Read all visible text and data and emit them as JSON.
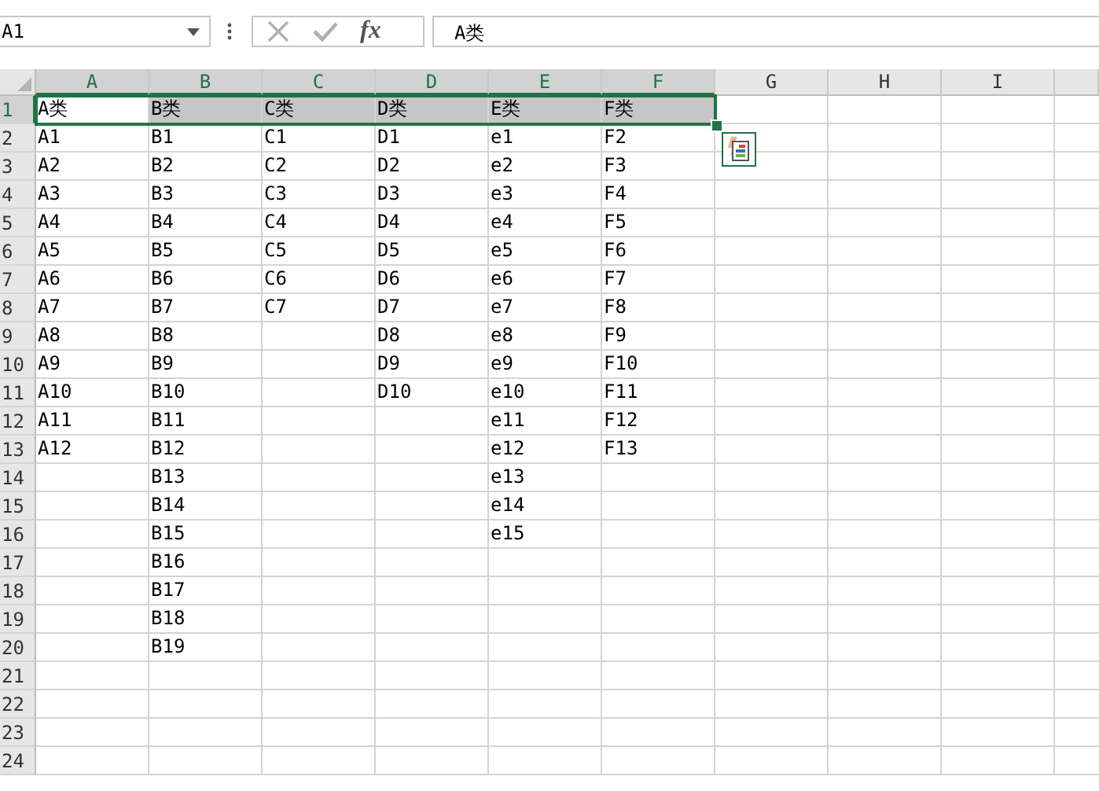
{
  "name_box": {
    "value": "A1"
  },
  "formula_bar": {
    "cancel_disabled": true,
    "enter_disabled": true,
    "function_label": "fx",
    "value": "A类"
  },
  "columns": [
    {
      "header": "A",
      "selected": true,
      "active": true,
      "cells": [
        "A类",
        "A1",
        "A2",
        "A3",
        "A4",
        "A5",
        "A6",
        "A7",
        "A8",
        "A9",
        "A10",
        "A11",
        "A12"
      ]
    },
    {
      "header": "B",
      "selected": true,
      "active": false,
      "cells": [
        "B类",
        "B1",
        "B2",
        "B3",
        "B4",
        "B5",
        "B6",
        "B7",
        "B8",
        "B9",
        "B10",
        "B11",
        "B12",
        "B13",
        "B14",
        "B15",
        "B16",
        "B17",
        "B18",
        "B19"
      ]
    },
    {
      "header": "C",
      "selected": true,
      "active": false,
      "cells": [
        "C类",
        "C1",
        "C2",
        "C3",
        "C4",
        "C5",
        "C6",
        "C7"
      ]
    },
    {
      "header": "D",
      "selected": true,
      "active": false,
      "cells": [
        "D类",
        "D1",
        "D2",
        "D3",
        "D4",
        "D5",
        "D6",
        "D7",
        "D8",
        "D9",
        "D10"
      ]
    },
    {
      "header": "E",
      "selected": true,
      "active": false,
      "cells": [
        "E类",
        "e1",
        "e2",
        "e3",
        "e4",
        "e5",
        "e6",
        "e7",
        "e8",
        "e9",
        "e10",
        "e11",
        "e12",
        "e13",
        "e14",
        "e15"
      ]
    },
    {
      "header": "F",
      "selected": true,
      "active": false,
      "cells": [
        "F类",
        "F2",
        "F3",
        "F4",
        "F5",
        "F6",
        "F7",
        "F8",
        "F9",
        "F10",
        "F11",
        "F12",
        "F13"
      ]
    },
    {
      "header": "G",
      "selected": false
    },
    {
      "header": "H",
      "selected": false
    },
    {
      "header": "I",
      "selected": false
    }
  ],
  "rows": [
    {
      "label": "1",
      "selected": true
    },
    {
      "label": "2",
      "selected": false
    },
    {
      "label": "3",
      "selected": false
    },
    {
      "label": "4",
      "selected": false
    },
    {
      "label": "5",
      "selected": false
    },
    {
      "label": "6",
      "selected": false
    },
    {
      "label": "7",
      "selected": false
    },
    {
      "label": "8",
      "selected": false
    },
    {
      "label": "9",
      "selected": false
    },
    {
      "label": "10",
      "selected": false
    },
    {
      "label": "11",
      "selected": false
    },
    {
      "label": "12",
      "selected": false
    },
    {
      "label": "13",
      "selected": false
    },
    {
      "label": "14",
      "selected": false
    },
    {
      "label": "15",
      "selected": false
    },
    {
      "label": "16",
      "selected": false
    },
    {
      "label": "17",
      "selected": false
    },
    {
      "label": "18",
      "selected": false
    },
    {
      "label": "19",
      "selected": false
    },
    {
      "label": "20",
      "selected": false
    },
    {
      "label": "21",
      "selected": false
    },
    {
      "label": "22",
      "selected": false
    },
    {
      "label": "23",
      "selected": false
    },
    {
      "label": "24",
      "selected": false
    }
  ]
}
